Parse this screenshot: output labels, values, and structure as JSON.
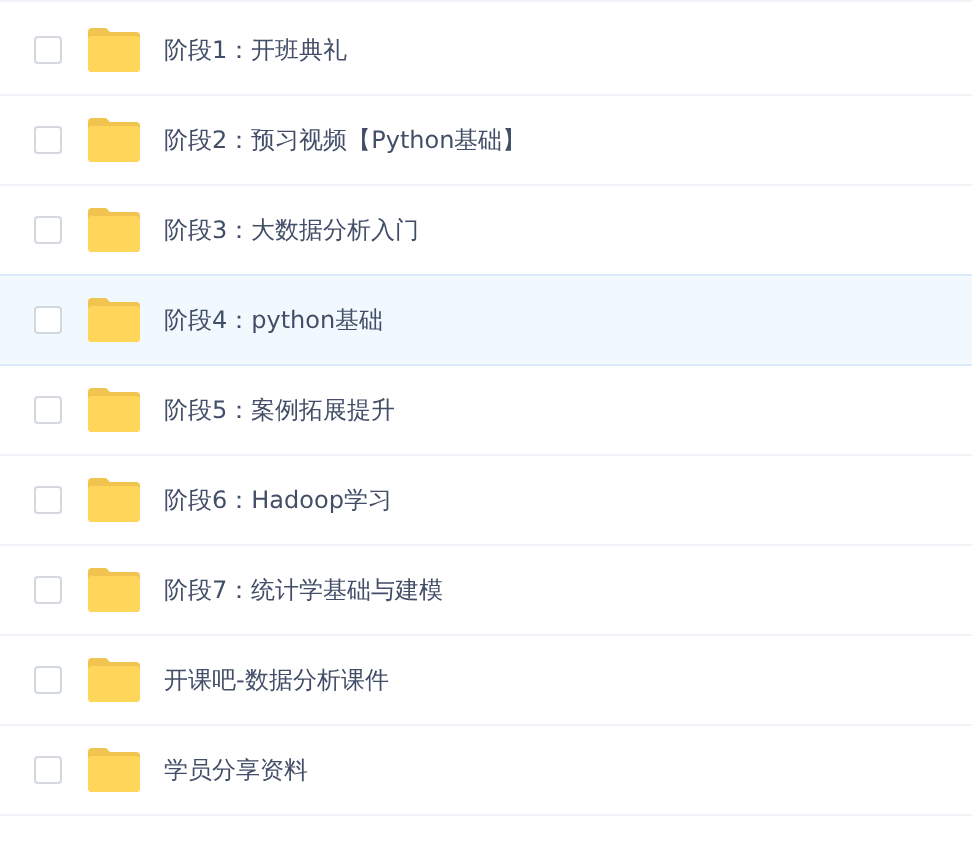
{
  "files": [
    {
      "name": "阶段1：开班典礼",
      "checked": false,
      "selected": false
    },
    {
      "name": "阶段2：预习视频【Python基础】",
      "checked": false,
      "selected": false
    },
    {
      "name": "阶段3：大数据分析入门",
      "checked": false,
      "selected": false
    },
    {
      "name": "阶段4：python基础",
      "checked": false,
      "selected": true
    },
    {
      "name": "阶段5：案例拓展提升",
      "checked": false,
      "selected": false
    },
    {
      "name": "阶段6：Hadoop学习",
      "checked": false,
      "selected": false
    },
    {
      "name": "阶段7：统计学基础与建模",
      "checked": false,
      "selected": false
    },
    {
      "name": "开课吧-数据分析课件",
      "checked": false,
      "selected": false
    },
    {
      "name": "学员分享资料",
      "checked": false,
      "selected": false
    }
  ]
}
